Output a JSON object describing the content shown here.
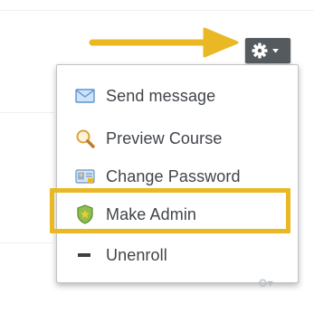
{
  "menu": {
    "items": [
      {
        "label": "Send message",
        "icon": "envelope-icon"
      },
      {
        "label": "Preview Course",
        "icon": "magnifier-icon"
      },
      {
        "label": "Change Password",
        "icon": "id-card-icon"
      },
      {
        "label": "Make Admin",
        "icon": "shield-star-icon"
      },
      {
        "label": "Unenroll",
        "icon": "minus-icon"
      }
    ],
    "highlighted_item": "Make Admin"
  },
  "gear_button": {
    "icon": "gear-icon",
    "caret_icon": "caret-down-icon"
  },
  "annotations": {
    "arrow_icon": "pointer-arrow-icon"
  },
  "colors": {
    "annotation_yellow": "#e9b824",
    "gear_button_bg": "#555a5f",
    "menu_text": "#404449"
  }
}
